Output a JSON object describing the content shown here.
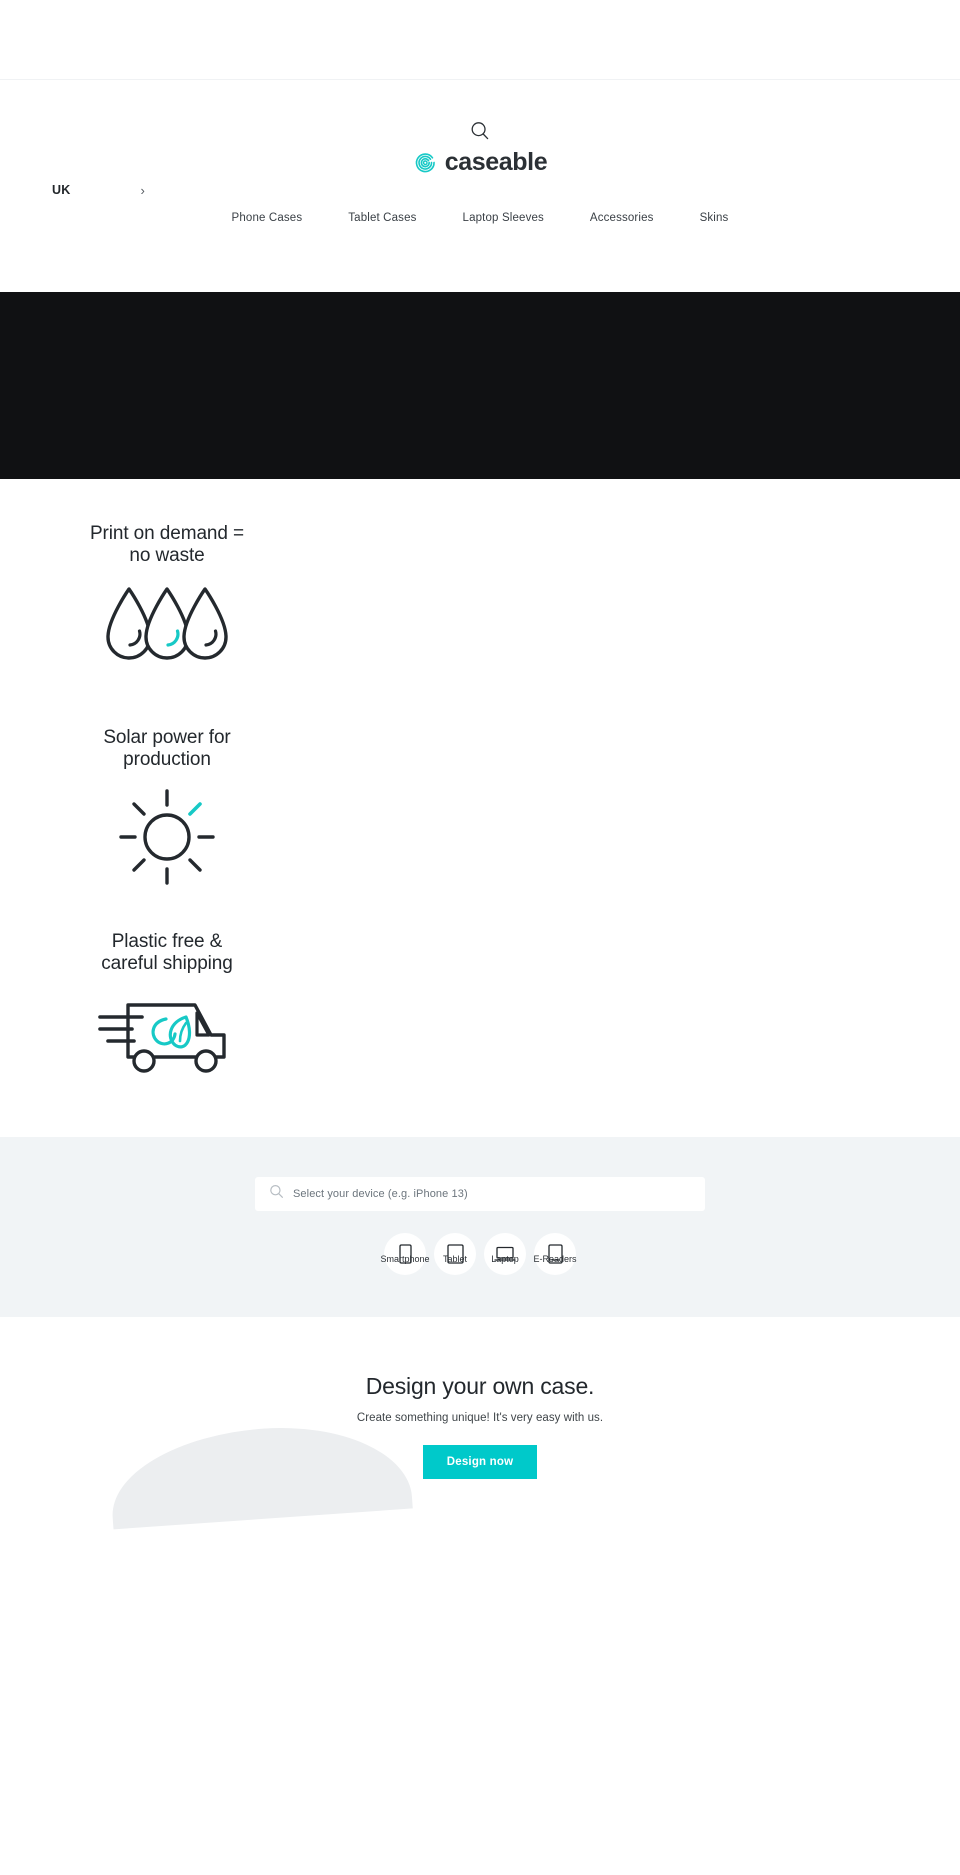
{
  "header": {
    "search_icon": "search-icon",
    "brand": {
      "mark": "caseable-spiral-logo",
      "word": "caseable"
    },
    "country": {
      "label": "UK",
      "chevron": "›"
    },
    "nav": [
      {
        "label": "Phone Cases"
      },
      {
        "label": "Tablet Cases"
      },
      {
        "label": "Laptop Sleeves"
      },
      {
        "label": "Accessories"
      },
      {
        "label": "Skins"
      }
    ]
  },
  "hero": {
    "background_color": "#101113"
  },
  "features": [
    {
      "title": "Print on demand = no waste",
      "icon": "water-droplets-icon",
      "accent_color": "#17c9c6"
    },
    {
      "title": "Solar power for production",
      "icon": "sun-icon",
      "accent_color": "#17c9c6"
    },
    {
      "title": "Plastic free & careful shipping",
      "icon": "delivery-truck-leaf-icon",
      "accent_color": "#17c9c6"
    }
  ],
  "finder": {
    "search_icon": "search-icon",
    "placeholder": "Select your device (e.g. iPhone 13)",
    "value": "",
    "categories": [
      {
        "label": "Smartphone",
        "icon": "smartphone-icon"
      },
      {
        "label": "Tablet",
        "icon": "tablet-icon"
      },
      {
        "label": "Laptop",
        "icon": "laptop-icon"
      },
      {
        "label": "E-Readers",
        "icon": "ereader-icon"
      }
    ]
  },
  "design": {
    "title": "Design your own case.",
    "subtitle": "Create something unique! It's very easy with us.",
    "button_label": "Design now",
    "button_color": "#00c9ca"
  }
}
